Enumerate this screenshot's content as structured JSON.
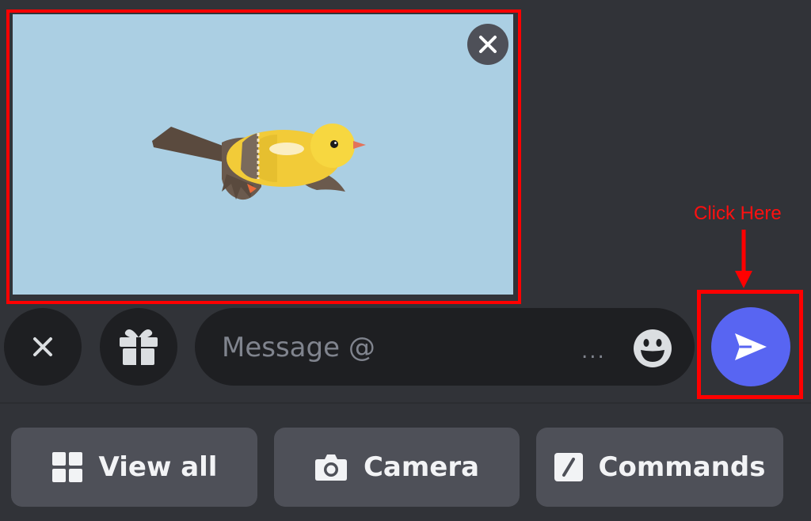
{
  "composer": {
    "message_placeholder": "Message @",
    "more_label": "...",
    "send_icon": "send-icon",
    "emoji_icon": "emoji-icon",
    "gift_icon": "gift-icon",
    "close_icon": "close-icon"
  },
  "attachment": {
    "image": "yellow-bird",
    "remove_icon": "close-icon"
  },
  "annotation": {
    "text": "Click Here",
    "color": "#ff0000"
  },
  "bottom_bar": {
    "items": [
      {
        "label": "View all",
        "icon": "grid-icon"
      },
      {
        "label": "Camera",
        "icon": "camera-icon"
      },
      {
        "label": "Commands",
        "icon": "slash-command-icon"
      }
    ]
  },
  "colors": {
    "background": "#313338",
    "input_background": "#1e1f22",
    "send_button": "#5865f2",
    "preview_background": "#abcfe3",
    "bar_button": "#4e5058"
  }
}
